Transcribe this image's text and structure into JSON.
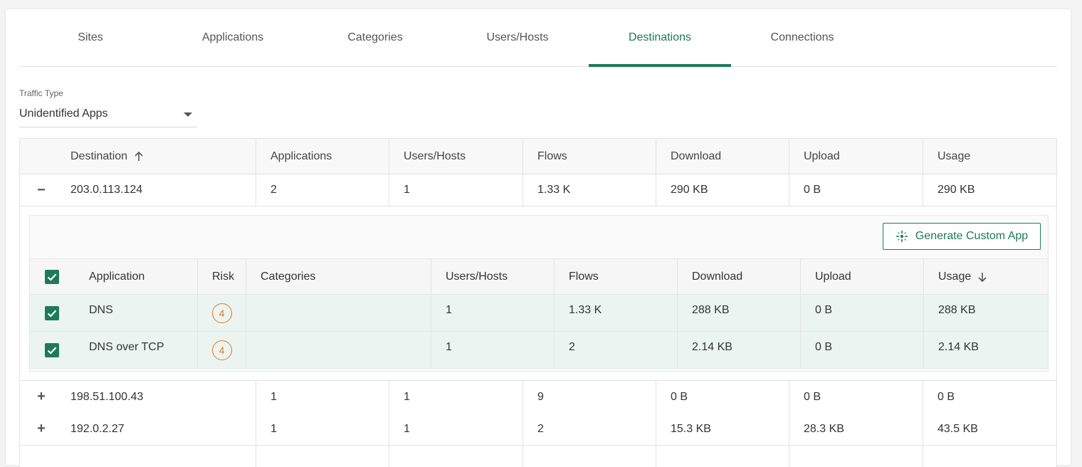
{
  "tabs": [
    {
      "label": "Sites"
    },
    {
      "label": "Applications"
    },
    {
      "label": "Categories"
    },
    {
      "label": "Users/Hosts"
    },
    {
      "label": "Destinations",
      "active": true
    },
    {
      "label": "Connections"
    }
  ],
  "traffic_type": {
    "label": "Traffic Type",
    "value": "Unidentified Apps"
  },
  "table": {
    "headers": [
      "Destination",
      "Applications",
      "Users/Hosts",
      "Flows",
      "Download",
      "Upload",
      "Usage"
    ],
    "sort_icon": "arrow-up-icon",
    "rows": [
      {
        "expander": "−",
        "destination": "203.0.113.124",
        "applications": "2",
        "users_hosts": "1",
        "flows": "1.33 K",
        "download": "290 KB",
        "upload": "0 B",
        "usage": "290 KB"
      },
      {
        "expander": "+",
        "destination": "198.51.100.43",
        "applications": "1",
        "users_hosts": "1",
        "flows": "9",
        "download": "0 B",
        "upload": "0 B",
        "usage": "0 B"
      },
      {
        "expander": "+",
        "destination": "192.0.2.27",
        "applications": "1",
        "users_hosts": "1",
        "flows": "2",
        "download": "15.3 KB",
        "upload": "28.3 KB",
        "usage": "43.5 KB"
      }
    ]
  },
  "detail": {
    "generate_button": "Generate Custom App",
    "generate_icon": "sparkle-icon",
    "headers": [
      "Application",
      "Risk",
      "Categories",
      "Users/Hosts",
      "Flows",
      "Download",
      "Upload",
      "Usage"
    ],
    "sort_icon": "arrow-down-icon",
    "rows": [
      {
        "application": "DNS",
        "risk": "4",
        "categories": "",
        "users_hosts": "1",
        "flows": "1.33 K",
        "download": "288 KB",
        "upload": "0 B",
        "usage": "288 KB"
      },
      {
        "application": "DNS over TCP",
        "risk": "4",
        "categories": "",
        "users_hosts": "1",
        "flows": "2",
        "download": "2.14 KB",
        "upload": "0 B",
        "usage": "2.14 KB"
      }
    ]
  },
  "colors": {
    "accent": "#1e7a5a",
    "risk": "#e07b22",
    "selected_row": "#ebf4f0"
  }
}
